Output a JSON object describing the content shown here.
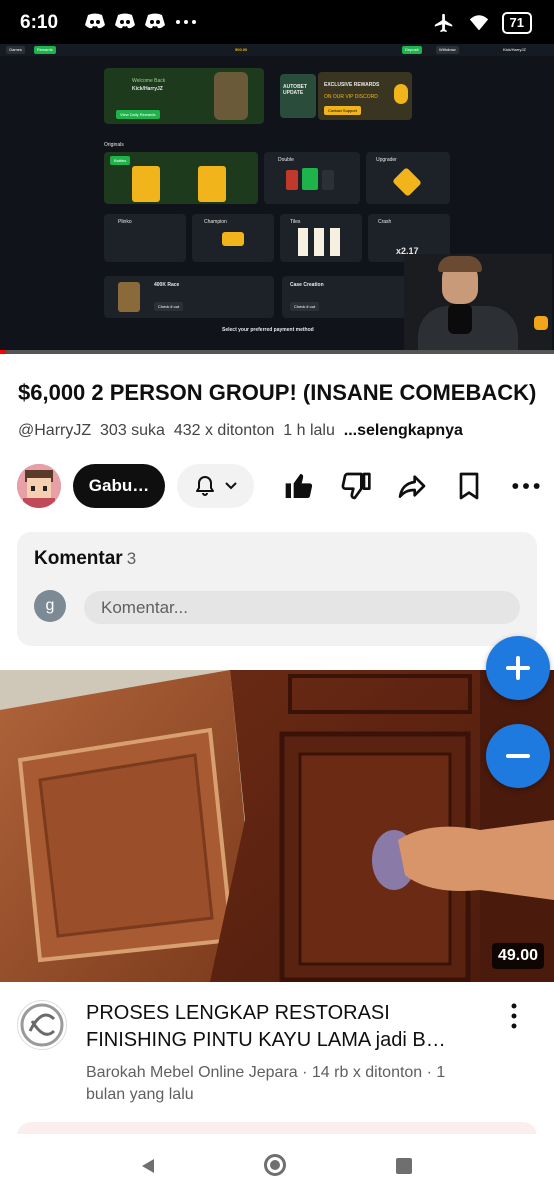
{
  "status_bar": {
    "time": "6:10",
    "battery": "71",
    "left_icons": [
      "discord-icon",
      "discord-icon",
      "discord-icon",
      "more-dots-icon"
    ],
    "right_icons": [
      "airplane-icon",
      "wifi-icon",
      "battery-icon"
    ]
  },
  "video": {
    "progress_fraction": 0.01,
    "overlay": {
      "nav_games": "Games",
      "nav_rewards": "Rewards",
      "balance": "500.00",
      "deposit": "Deposit",
      "withdraw": "Withdraw",
      "user": "Kick/HarryJZ",
      "welcome": "Welcome Back",
      "welcome_user": "Kick/HarryJZ",
      "daily_rewards": "View Daily Rewards",
      "autobet": "AUTOBET UPDATE",
      "exclusive": "EXCLUSIVE REWARDS",
      "vip_discord": "ON OUR VIP DISCORD",
      "contact_support": "Contact Support",
      "originals": "Originals",
      "battles": "Battles",
      "double": "Double",
      "upgrader": "Upgrader",
      "plinko": "Plinko",
      "champion": "Champion",
      "tiles": "Tiles",
      "crash": "Crash",
      "crash_multiplier": "x2.17",
      "race": "400K Race",
      "check_it_out": "Check it out",
      "case_creation": "Case Creation",
      "payment_prompt": "Select your preferred payment method"
    }
  },
  "title": "$6,000 2 PERSON GROUP! (INSANE COMEBACK)",
  "meta": {
    "handle": "@HarryJZ",
    "likes": "303 suka",
    "views": "432 x ditonton",
    "age": "1 h lalu",
    "more": "...selengkapnya"
  },
  "actions": {
    "join": "Gabu…",
    "icons": [
      "bell-icon",
      "chevron-down-icon",
      "like-icon",
      "dislike-icon",
      "share-icon",
      "save-icon",
      "more-icon"
    ]
  },
  "comments": {
    "header": "Komentar",
    "count": "3",
    "avatar_letter": "g",
    "placeholder": "Komentar..."
  },
  "zoom": {
    "plus": "+",
    "minus": "−"
  },
  "next_video": {
    "duration": "49.00",
    "title": "PROSES LENGKAP RESTORASI FINISHING PINTU KAYU LAMA jadi B…",
    "channel": "Barokah Mebel Online Jepara",
    "views": "14 rb x ditonton",
    "age": "1 bulan yang lalu"
  },
  "nav": {
    "icons": [
      "back-icon",
      "home-icon",
      "recents-icon"
    ]
  },
  "colors": {
    "accent_blue": "#1f7ae0",
    "brand_green": "#1fb34c",
    "gold": "#f1b51b",
    "progress_red": "#ff0000"
  }
}
